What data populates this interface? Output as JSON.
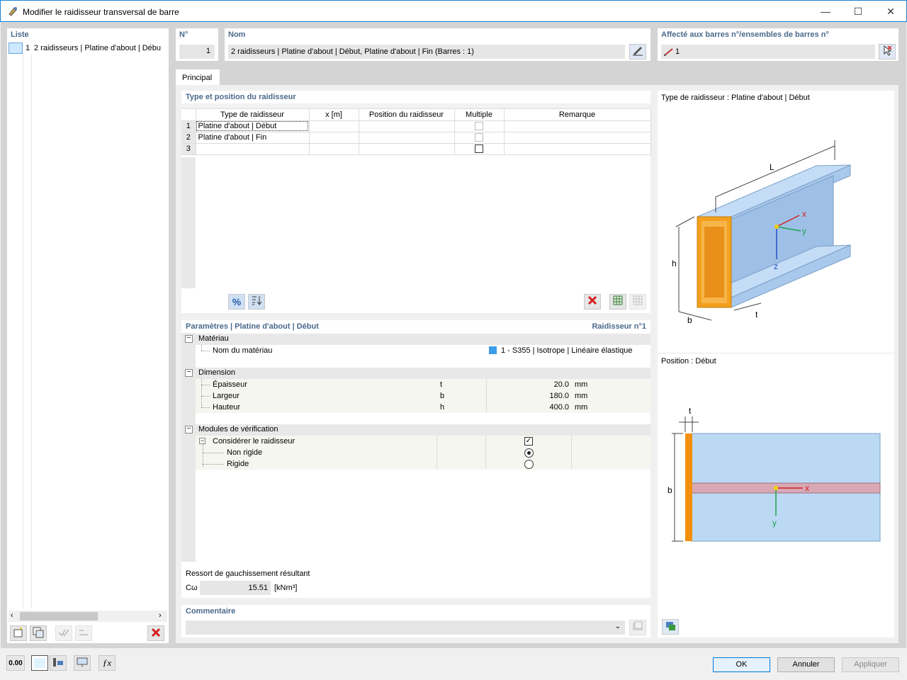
{
  "window": {
    "title": "Modifier le raidisseur transversal de barre",
    "min": "—",
    "max": "☐",
    "close": "✕"
  },
  "list": {
    "header": "Liste",
    "items": [
      {
        "num": "1",
        "label": "2 raidisseurs | Platine d'about | Débu"
      }
    ]
  },
  "number": {
    "label": "N°",
    "value": "1"
  },
  "name": {
    "label": "Nom",
    "value": "2 raidisseurs | Platine d'about | Début, Platine d'about | Fin (Barres : 1)"
  },
  "assigned": {
    "label": "Affecté aux barres n°/ensembles de barres n°",
    "value": "1"
  },
  "tabs": [
    {
      "label": "Principal"
    }
  ],
  "stiffener_table": {
    "header": "Type et position du raidisseur",
    "columns": [
      "Type de raidisseur",
      "x [m]",
      "Position du raidisseur",
      "Multiple",
      "Remarque"
    ],
    "rows": [
      {
        "num": "1",
        "type": "Platine d'about | Début",
        "x": "",
        "position": "",
        "remark": ""
      },
      {
        "num": "2",
        "type": "Platine d'about | Fin",
        "x": "",
        "position": "",
        "remark": ""
      },
      {
        "num": "3",
        "type": "",
        "x": "",
        "position": "",
        "remark": ""
      }
    ]
  },
  "params": {
    "header": "Paramètres | Platine d'about | Début",
    "right": "Raidisseur n°1",
    "material": {
      "section": "Matériau",
      "name_label": "Nom du matériau",
      "value": "1 - S355 | Isotrope | Linéaire élastique",
      "color": "#3d9ee8"
    },
    "dimension": {
      "section": "Dimension",
      "rows": [
        {
          "label": "Épaisseur",
          "sym": "t",
          "value": "20.0",
          "unit": "mm"
        },
        {
          "label": "Largeur",
          "sym": "b",
          "value": "180.0",
          "unit": "mm"
        },
        {
          "label": "Hauteur",
          "sym": "h",
          "value": "400.0",
          "unit": "mm"
        }
      ]
    },
    "modules": {
      "section": "Modules de vérification",
      "consider": "Considérer le raidisseur",
      "nonrigid": "Non rigide",
      "rigid": "Rigide"
    }
  },
  "spring": {
    "label": "Ressort de gauchissement résultant",
    "sym": "Cω",
    "value": "15.51",
    "unit": "[kNm³]"
  },
  "comment": {
    "label": "Commentaire",
    "value": ""
  },
  "preview": {
    "type_title": "Type de raidisseur : Platine d'about | Début",
    "pos_title": "Position : Début",
    "labels": {
      "L": "L",
      "h": "h",
      "b": "b",
      "t": "t",
      "x": "x",
      "y": "y",
      "z": "z"
    }
  },
  "buttons": {
    "ok": "OK",
    "cancel": "Annuler",
    "apply": "Appliquer"
  },
  "colors": {
    "accent": "#1883d7",
    "header_text": "#4a6a8c",
    "steel": "#a8c8ec",
    "plate": "#f2a01e",
    "red": "#d42020"
  }
}
